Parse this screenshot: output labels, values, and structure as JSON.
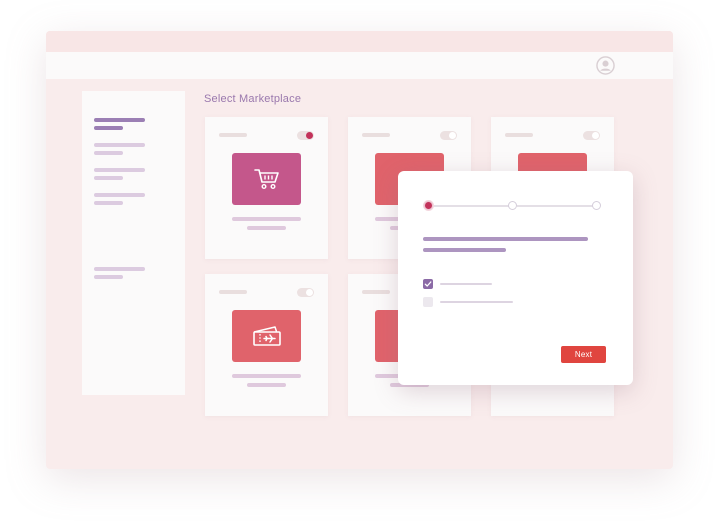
{
  "header": {
    "avatar_icon": "user-avatar-icon"
  },
  "main": {
    "title": "Select Marketplace",
    "cards": [
      {
        "id": "shopping",
        "icon": "shopping-cart-icon",
        "tile_color": "#c4578b",
        "toggle_on": true
      },
      {
        "id": "card-2",
        "icon": "hidden-icon",
        "tile_color": "#e0636b",
        "toggle_on": false
      },
      {
        "id": "card-3",
        "icon": "hidden-icon",
        "tile_color": "#e0636b",
        "toggle_on": false
      },
      {
        "id": "travel",
        "icon": "plane-ticket-icon",
        "tile_color": "#e0636b",
        "toggle_on": false
      },
      {
        "id": "card-5",
        "icon": "hidden-icon",
        "tile_color": "#e0636b",
        "toggle_on": false
      },
      {
        "id": "card-6",
        "icon": "hidden-icon",
        "tile_color": "#e0636b",
        "toggle_on": false
      }
    ]
  },
  "modal": {
    "steps_total": 3,
    "current_step": 1,
    "options": [
      {
        "checked": true
      },
      {
        "checked": false
      }
    ],
    "next_label": "Next"
  },
  "colors": {
    "accent_purple": "#8b6aa6",
    "accent_red": "#e0453f",
    "active_dot": "#c2325a"
  }
}
